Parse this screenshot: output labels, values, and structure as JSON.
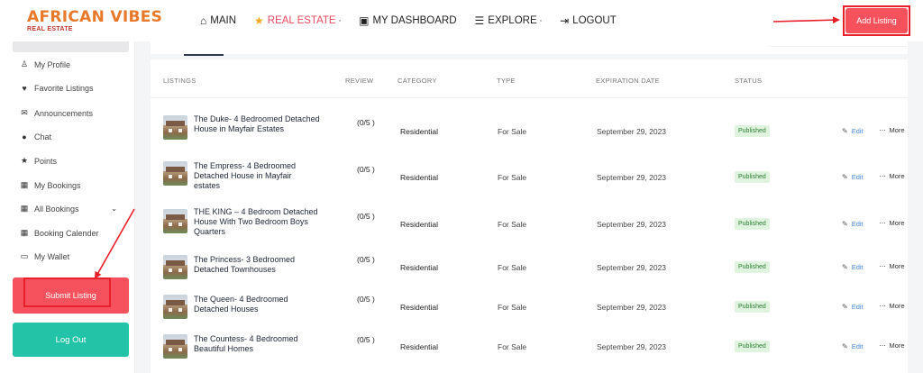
{
  "brand": {
    "name": "AFRICAN VIBES",
    "tagline": "REAL ESTATE",
    "name_color": "#e8792b",
    "tagline_color": "#c0392b"
  },
  "nav": [
    {
      "label": "MAIN",
      "icon": "home-icon",
      "glyph": "⌂",
      "dropdown": ""
    },
    {
      "label": "REAL ESTATE",
      "icon": "star-icon",
      "glyph": "★",
      "dropdown": "▫",
      "active": true
    },
    {
      "label": "MY DASHBOARD",
      "icon": "id-card-icon",
      "glyph": "▣",
      "dropdown": ""
    },
    {
      "label": "EXPLORE",
      "icon": "list-icon",
      "glyph": "☰",
      "dropdown": "▫"
    },
    {
      "label": "LOGOUT",
      "icon": "logout-icon",
      "glyph": "⇥",
      "dropdown": ""
    }
  ],
  "header": {
    "add_listing_label": "Add Listing",
    "accent": "#f5525e"
  },
  "sidebar": {
    "items": [
      {
        "label": "My Profile",
        "icon": "user-icon",
        "glyph": "♙"
      },
      {
        "label": "Favorite Listings",
        "icon": "heart-icon",
        "glyph": "♥"
      },
      {
        "label": "Announcements",
        "icon": "megaphone-icon",
        "glyph": "✉"
      },
      {
        "label": "Chat",
        "icon": "chat-icon",
        "glyph": "●"
      },
      {
        "label": "Points",
        "icon": "star-icon",
        "glyph": "★"
      },
      {
        "label": "My Bookings",
        "icon": "calendar-icon",
        "glyph": "▦"
      },
      {
        "label": "All Bookings",
        "icon": "calendar-icon",
        "glyph": "▦",
        "chevron": "⌄"
      },
      {
        "label": "Booking Calender",
        "icon": "calendar-icon",
        "glyph": "▦"
      },
      {
        "label": "My Wallet",
        "icon": "wallet-icon",
        "glyph": "▭"
      }
    ],
    "submit_label": "Submit Listing",
    "logout_label": "Log Out",
    "logout_color": "#22c3a6"
  },
  "table": {
    "columns": [
      "LISTINGS",
      "REVIEW",
      "CATEGORY",
      "TYPE",
      "EXPIRATION DATE",
      "STATUS"
    ],
    "edit_label": "Edit",
    "more_label": "More",
    "rows": [
      {
        "title": "The Duke- 4 Bedroomed Detached House in Mayfair Estates",
        "review": "(0/5 )",
        "category": "Residential",
        "type": "For Sale",
        "expiration": "September 29, 2023",
        "status": "Published"
      },
      {
        "title": "The Empress- 4 Bedroomed Detached House in Mayfair estates",
        "review": "(0/5 )",
        "category": "Residential",
        "type": "For Sale",
        "expiration": "September 29, 2023",
        "status": "Published"
      },
      {
        "title": "THE KING – 4 Bedroom Detached House With Two Bedroom Boys Quarters",
        "review": "(0/5 )",
        "category": "Residential",
        "type": "For Sale",
        "expiration": "September 29, 2023",
        "status": "Published"
      },
      {
        "title": "The Princess- 3 Bedroomed Detached Townhouses",
        "review": "(0/5 )",
        "category": "Residential",
        "type": "For Sale",
        "expiration": "September 29, 2023",
        "status": "Published"
      },
      {
        "title": "The Queen- 4 Bedroomed Detached Houses",
        "review": "(0/5 )",
        "category": "Residential",
        "type": "For Sale",
        "expiration": "September 29, 2023",
        "status": "Published"
      },
      {
        "title": "The Countess- 4 Bedroomed Beautiful Homes",
        "review": "(0/5 )",
        "category": "Residential",
        "type": "For Sale",
        "expiration": "September 29, 2023",
        "status": "Published"
      }
    ]
  }
}
